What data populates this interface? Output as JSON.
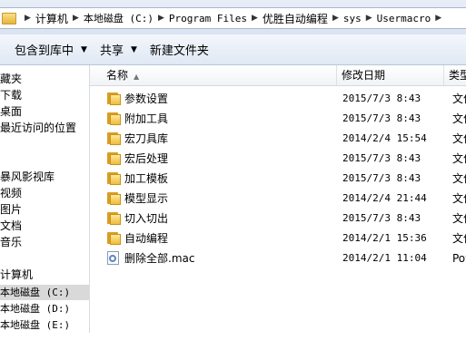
{
  "address": {
    "crumbs": [
      "计算机",
      "本地磁盘 (C:)",
      "Program Files",
      "优胜自动编程",
      "sys",
      "Usermacro"
    ]
  },
  "toolbar": {
    "include_label": "包含到库中",
    "share_label": "共享",
    "new_folder_label": "新建文件夹"
  },
  "nav": {
    "items": [
      "藏夹",
      "下载",
      "桌面",
      "最近访问的位置",
      "暴风影视库",
      "视频",
      "图片",
      "文档",
      "音乐",
      "计算机",
      "本地磁盘 (C:)",
      "本地磁盘 (D:)",
      "本地磁盘 (E:)"
    ],
    "selected": "本地磁盘 (C:)"
  },
  "columns": {
    "name": "名称",
    "date": "修改日期",
    "type": "类型"
  },
  "files": [
    {
      "name": "参数设置",
      "date": "2015/7/3 8:43",
      "type": "文件",
      "kind": "folder"
    },
    {
      "name": "附加工具",
      "date": "2015/7/3 8:43",
      "type": "文件",
      "kind": "folder"
    },
    {
      "name": "宏刀具库",
      "date": "2014/2/4 15:54",
      "type": "文件",
      "kind": "folder"
    },
    {
      "name": "宏后处理",
      "date": "2015/7/3 8:43",
      "type": "文件",
      "kind": "folder"
    },
    {
      "name": "加工模板",
      "date": "2015/7/3 8:43",
      "type": "文件",
      "kind": "folder"
    },
    {
      "name": "模型显示",
      "date": "2014/2/4 21:44",
      "type": "文件",
      "kind": "folder"
    },
    {
      "name": "切入切出",
      "date": "2015/7/3 8:43",
      "type": "文件",
      "kind": "folder"
    },
    {
      "name": "自动编程",
      "date": "2014/2/1 15:36",
      "type": "文件",
      "kind": "folder"
    },
    {
      "name": "删除全部.mac",
      "date": "2014/2/1 11:04",
      "type": "Pow",
      "kind": "file"
    }
  ]
}
